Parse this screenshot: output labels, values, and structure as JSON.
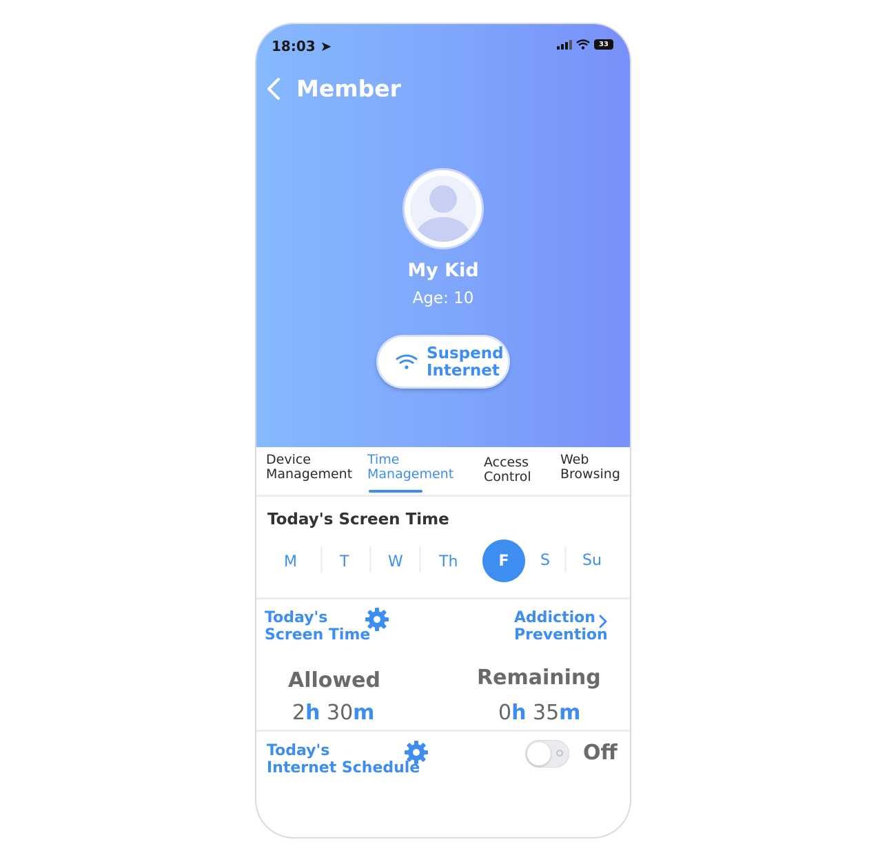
{
  "status": {
    "time": "18:03",
    "battery": "33"
  },
  "header": {
    "title": "Member"
  },
  "profile": {
    "name": "My Kid",
    "age": "Age: 10"
  },
  "suspend": {
    "line1": "Suspend",
    "line2": "Internet"
  },
  "tabs": [
    {
      "line1": "Device",
      "line2": "Management"
    },
    {
      "line1": "Time",
      "line2": "Management"
    },
    {
      "line1": "Access",
      "line2": "Control"
    },
    {
      "line1": "Web",
      "line2": "Browsing"
    }
  ],
  "screen_time": {
    "title": "Today's Screen Time",
    "days": [
      "M",
      "T",
      "W",
      "Th",
      "F",
      "S",
      "Su"
    ],
    "selected_day": "F"
  },
  "links": {
    "screen_time": {
      "line1": "Today's",
      "line2": "Screen Time"
    },
    "addiction": {
      "line1": "Addiction",
      "line2": "Prevention"
    }
  },
  "stats": {
    "allowed": {
      "label": "Allowed",
      "hours": "2",
      "h_unit": "h",
      "minutes": " 30",
      "m_unit": "m"
    },
    "remaining": {
      "label": "Remaining",
      "hours": "0",
      "h_unit": "h",
      "minutes": " 35",
      "m_unit": "m"
    }
  },
  "schedule": {
    "line1": "Today's",
    "line2": "Internet Schedule",
    "toggle_state": "Off"
  },
  "colors": {
    "accent": "#3d8ef0",
    "hero_start": "#86b9fd",
    "hero_end": "#7790fa"
  }
}
